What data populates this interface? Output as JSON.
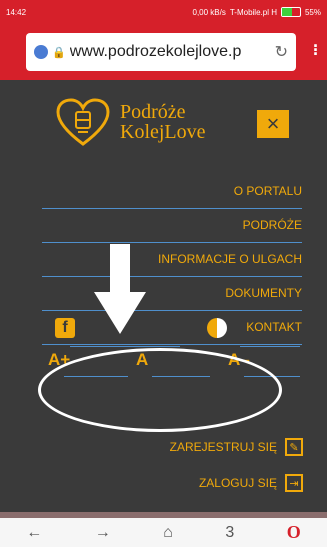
{
  "status_bar": {
    "time": "14:42",
    "right_text": "0,00 kB/s",
    "carrier": "T-Mobile.pl H",
    "battery": "55%"
  },
  "browser": {
    "url": "www.podrozekolejlove.p",
    "reload_icon": "reload-icon",
    "menu_icon": "overflow-menu-icon"
  },
  "site": {
    "logo_line1": "Podróże",
    "logo_line2": "KolejLove",
    "close_label": "×",
    "nav": [
      "O PORTALU",
      "PODRÓŻE",
      "INFORMACJE O ULGACH",
      "DOKUMENTY",
      "KONTAKT"
    ],
    "font_sizes": [
      "A+",
      "A",
      "A–"
    ],
    "facebook_icon": "facebook-icon",
    "contrast_icon": "contrast-icon",
    "register": "ZAREJESTRUJ SIĘ",
    "login": "ZALOGUJ SIĘ"
  },
  "colors": {
    "accent": "#f0a90b",
    "panel": "#3a3a3a",
    "line": "#4f8fcc",
    "browser": "#d6202a"
  },
  "navbar": {
    "back": "←",
    "forward": "→",
    "home": "⌂",
    "tabs": "3",
    "opera": "O"
  }
}
